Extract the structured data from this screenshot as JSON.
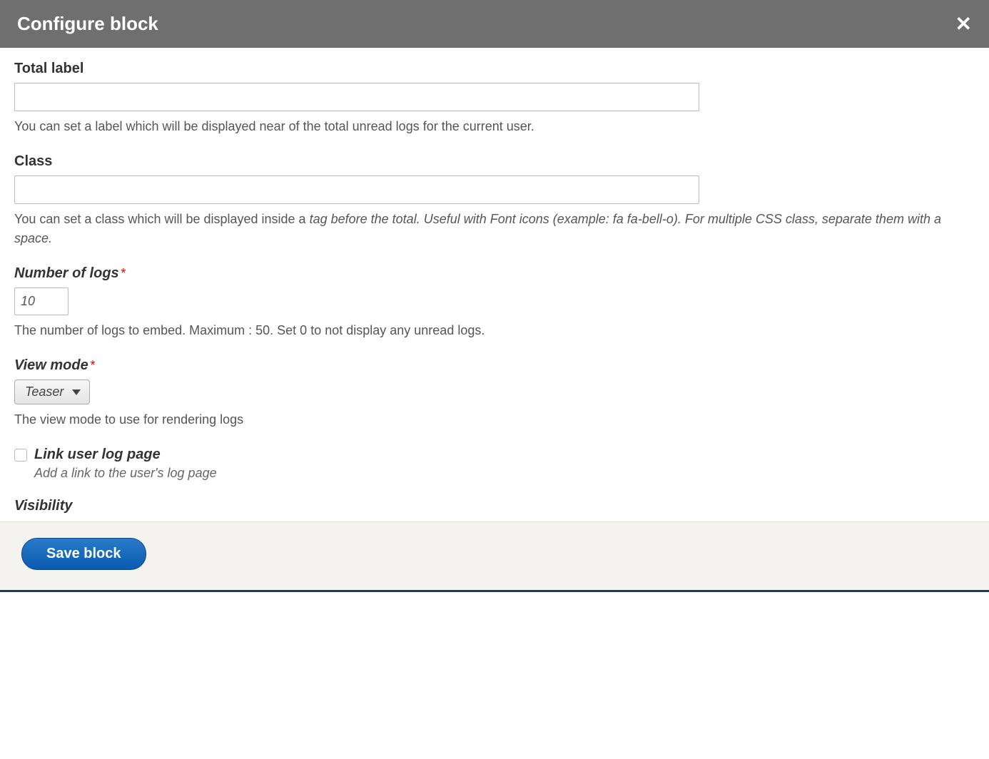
{
  "header": {
    "title": "Configure block",
    "close_glyph": "✕"
  },
  "fields": {
    "total_label": {
      "label": "Total label",
      "value": "",
      "desc": "You can set a label which will be displayed near of the total unread logs for the current user."
    },
    "class": {
      "label": "Class",
      "value": "",
      "desc_prefix": "You can set a class which will be displayed inside a ",
      "desc_italic": "tag before the total. Useful with Font icons (example: fa fa-bell-o). For multiple CSS class, separate them with a space."
    },
    "number_of_logs": {
      "label": "Number of logs",
      "value": "10",
      "desc": "The number of logs to embed. Maximum : 50. Set 0 to not display any unread logs."
    },
    "view_mode": {
      "label": "View mode",
      "value": "Teaser",
      "desc": "The view mode to use for rendering logs"
    },
    "link_user_log": {
      "label": "Link user log page",
      "checked": false,
      "desc": "Add a link to the user's log page"
    },
    "visibility": {
      "label": "Visibility"
    }
  },
  "footer": {
    "save_label": "Save block"
  }
}
